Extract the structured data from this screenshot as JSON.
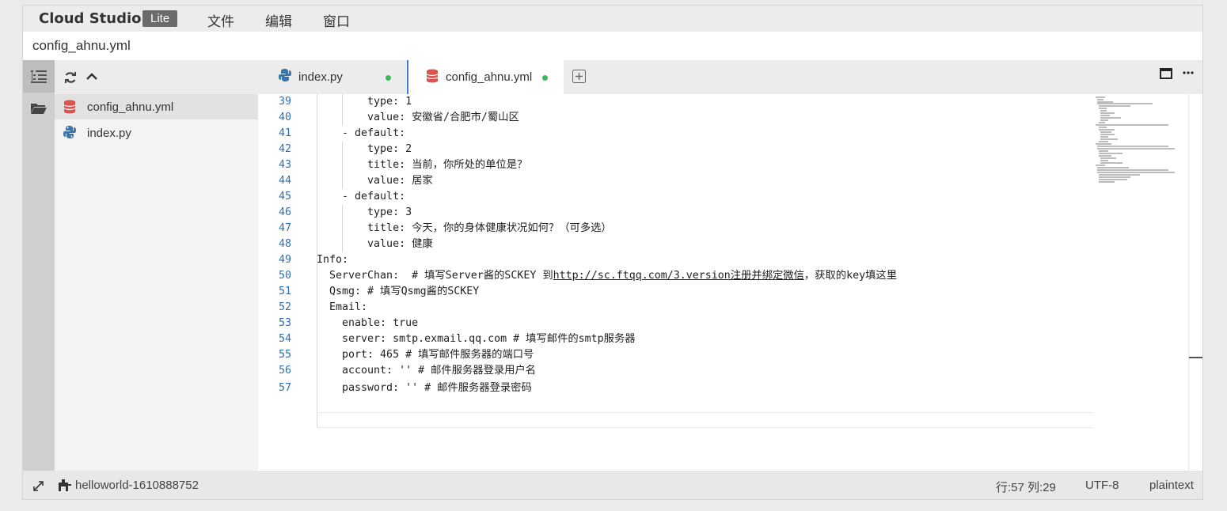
{
  "app": {
    "brand": "Cloud Studio",
    "edition": "Lite",
    "menu": [
      "文件",
      "编辑",
      "窗口"
    ]
  },
  "title_bar": {
    "file_name": "config_ahnu.yml"
  },
  "explorer": {
    "files": [
      {
        "name": "config_ahnu.yml",
        "icon": "database-icon",
        "active": true
      },
      {
        "name": "index.py",
        "icon": "python-icon",
        "active": false
      }
    ]
  },
  "tabs": [
    {
      "label": "index.py",
      "icon": "python-icon",
      "modified": true,
      "active": false
    },
    {
      "label": "config_ahnu.yml",
      "icon": "database-icon",
      "modified": true,
      "active": true
    }
  ],
  "editor": {
    "lines": [
      {
        "num": "39",
        "text": "        type: 1"
      },
      {
        "num": "40",
        "text": "        value: 安徽省/合肥市/蜀山区"
      },
      {
        "num": "41",
        "text": "    - default:"
      },
      {
        "num": "42",
        "text": "        type: 2"
      },
      {
        "num": "43",
        "text": "        title: 当前，你所处的单位是？"
      },
      {
        "num": "44",
        "text": "        value: 居家"
      },
      {
        "num": "45",
        "text": "    - default:"
      },
      {
        "num": "46",
        "text": "        type: 3"
      },
      {
        "num": "47",
        "text": "        title: 今天，你的身体健康状况如何？（可多选）"
      },
      {
        "num": "48",
        "text": "        value: 健康"
      },
      {
        "num": "49",
        "text": "Info:"
      },
      {
        "num": "50",
        "pre": "  ServerChan:  # 填写Server酱的SCKEY 到",
        "link": "http://sc.ftqq.com/3.version注册并绑定微信",
        "post": "，获取的key填这里"
      },
      {
        "num": "51",
        "text": "  Qsmg: # 填写Qsmg酱的SCKEY"
      },
      {
        "num": "52",
        "text": "  Email:"
      },
      {
        "num": "53",
        "text": "    enable: true"
      },
      {
        "num": "54",
        "text": "    server: smtp.exmail.qq.com # 填写邮件的smtp服务器"
      },
      {
        "num": "55",
        "text": "    port: 465 # 填写邮件服务器的端口号"
      },
      {
        "num": "56",
        "text": "    account: '' # 邮件服务器登录用户名"
      },
      {
        "num": "57",
        "text": "    password: '' # 邮件服务器登录密码"
      }
    ]
  },
  "status": {
    "workspace": "helloworld-1610888752",
    "cursor": "行:57 列:29",
    "encoding": "UTF-8",
    "language": "plaintext"
  },
  "colors": {
    "accent": "#3f7fd1",
    "modified_dot": "#3cba5a",
    "line_number": "#2a6fb4"
  }
}
